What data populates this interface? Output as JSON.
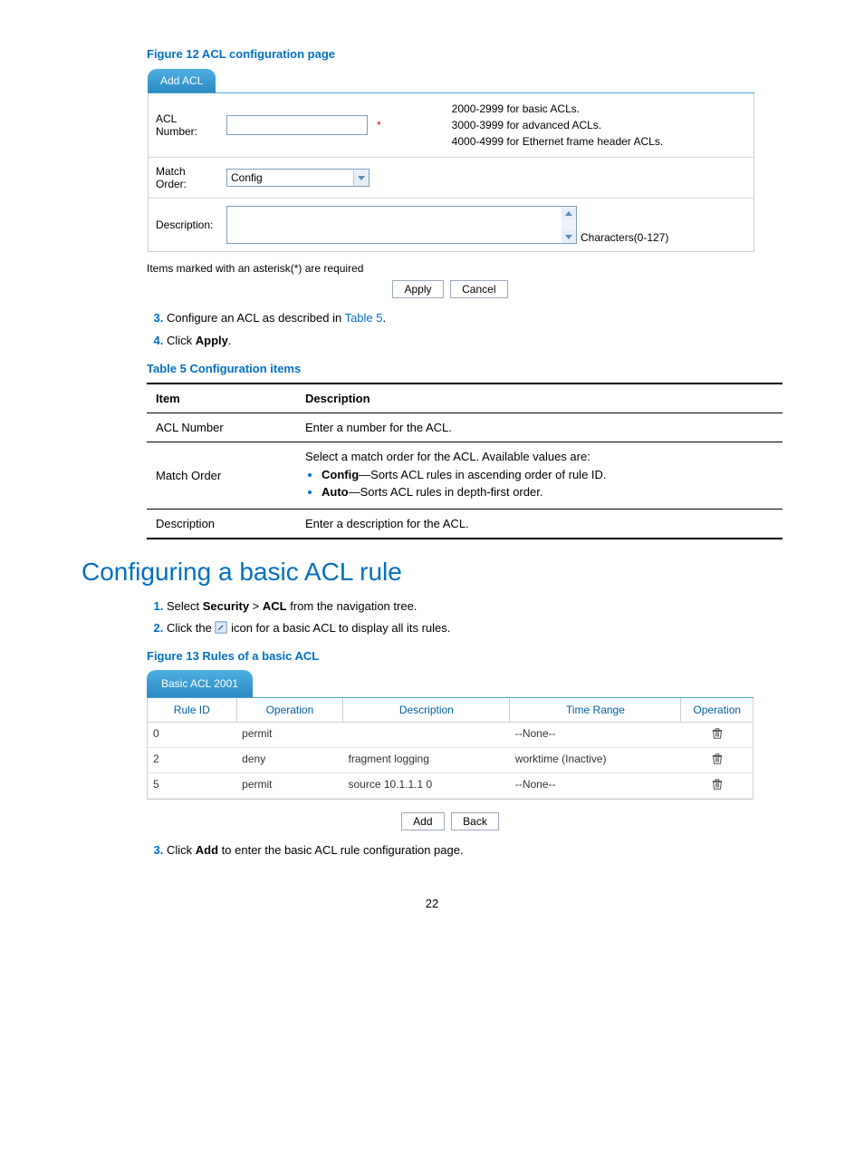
{
  "fig12": {
    "caption": "Figure 12 ACL configuration page",
    "tab": "Add ACL",
    "acl_number_label": "ACL Number:",
    "hint1": "2000-2999 for basic ACLs.",
    "hint2": "3000-3999 for advanced ACLs.",
    "hint3": "4000-4999 for Ethernet frame header ACLs.",
    "match_order_label": "Match Order:",
    "match_order_value": "Config",
    "description_label": "Description:",
    "chars_note": "Characters(0-127)",
    "req_note": "Items marked with an asterisk(*) are required",
    "apply": "Apply",
    "cancel": "Cancel"
  },
  "steps1": {
    "s3a": "Configure an ACL as described in ",
    "s3b": "Table 5",
    "s3c": ".",
    "s4a": "Click ",
    "s4b": "Apply",
    "s4c": "."
  },
  "table5": {
    "caption": "Table 5 Configuration items",
    "h1": "Item",
    "h2": "Description",
    "r1c1": "ACL Number",
    "r1c2": "Enter a number for the ACL.",
    "r2c1": "Match Order",
    "r2c2_intro": "Select a match order for the ACL. Available values are:",
    "r2c2_b1a": "Config",
    "r2c2_b1b": "—Sorts ACL rules in ascending order of rule ID.",
    "r2c2_b2a": "Auto",
    "r2c2_b2b": "—Sorts ACL rules in depth-first order.",
    "r3c1": "Description",
    "r3c2": "Enter a description for the ACL."
  },
  "section_title": "Configuring a basic ACL rule",
  "steps2": {
    "s1a": "Select ",
    "s1b": "Security",
    "s1c": " > ",
    "s1d": "ACL",
    "s1e": " from the navigation tree.",
    "s2a": "Click the ",
    "s2b": " icon for a basic ACL to display all its rules."
  },
  "fig13": {
    "caption": "Figure 13 Rules of a basic ACL",
    "tab": "Basic ACL 2001",
    "h_rid": "Rule ID",
    "h_op": "Operation",
    "h_desc": "Description",
    "h_tr": "Time Range",
    "h_op2": "Operation",
    "rows": [
      {
        "rid": "0",
        "op": "permit",
        "desc": "",
        "tr": "--None--"
      },
      {
        "rid": "2",
        "op": "deny",
        "desc": "fragment logging",
        "tr": "worktime (Inactive)"
      },
      {
        "rid": "5",
        "op": "permit",
        "desc": "source 10.1.1.1 0",
        "tr": "--None--"
      }
    ],
    "add": "Add",
    "back": "Back"
  },
  "steps3": {
    "s3a": "Click ",
    "s3b": "Add",
    "s3c": " to enter the basic ACL rule configuration page."
  },
  "page_number": "22"
}
